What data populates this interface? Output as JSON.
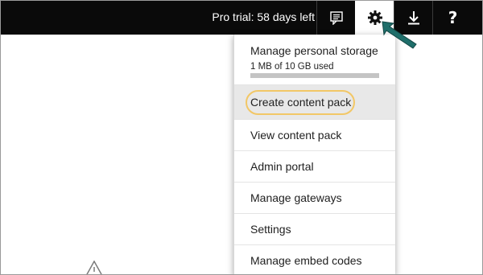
{
  "topbar": {
    "trial_text": "Pro trial: 58 days left",
    "icons": [
      "feedback-icon",
      "gear-icon",
      "download-icon",
      "help-icon"
    ],
    "help_label": "?",
    "active_icon": "gear-icon"
  },
  "settings_menu": {
    "storage": {
      "title": "Manage personal storage",
      "used_text": "1 MB of 10 GB used",
      "used_fraction": 0.0001
    },
    "items": [
      {
        "label": "Create content pack",
        "highlighted": true
      },
      {
        "label": "View content pack"
      },
      {
        "label": "Admin portal"
      },
      {
        "label": "Manage gateways"
      },
      {
        "label": "Settings"
      },
      {
        "label": "Manage embed codes"
      }
    ]
  },
  "annotations": {
    "callout_color": "#f2c766",
    "arrow_color": "#1f6e6a",
    "arrow_target": "gear-icon"
  },
  "colors": {
    "topbar_bg": "#0a0a0a",
    "menu_highlight": "#e8e8e8"
  }
}
